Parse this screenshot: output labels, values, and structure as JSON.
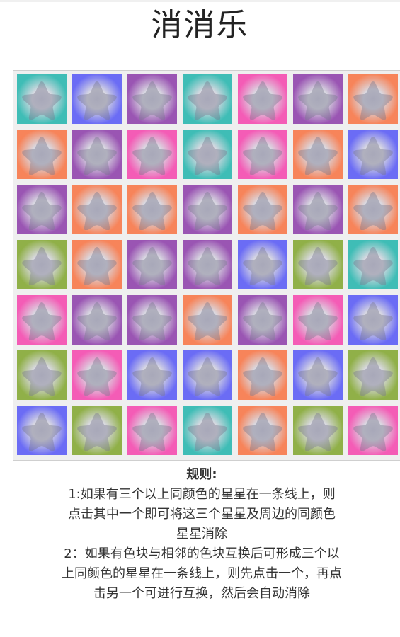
{
  "title": "消消乐",
  "colors": {
    "teal": "#3fbdb6",
    "purple": "#9a55b3",
    "pink": "#f45cb6",
    "orange": "#f7845a",
    "blue": "#6b6cf5",
    "green": "#90b048"
  },
  "icon": "star-icon",
  "board": {
    "rows": [
      [
        "teal",
        "blue",
        "purple",
        "teal",
        "pink",
        "purple",
        "orange"
      ],
      [
        "orange",
        "purple",
        "pink",
        "teal",
        "pink",
        "orange",
        "blue"
      ],
      [
        "purple",
        "orange",
        "orange",
        "purple",
        "orange",
        "purple",
        "orange"
      ],
      [
        "green",
        "orange",
        "purple",
        "purple",
        "blue",
        "green",
        "teal"
      ],
      [
        "pink",
        "purple",
        "purple",
        "orange",
        "purple",
        "pink",
        "blue"
      ],
      [
        "green",
        "pink",
        "blue",
        "blue",
        "orange",
        "blue",
        "green"
      ],
      [
        "blue",
        "green",
        "pink",
        "teal",
        "orange",
        "green",
        "pink"
      ]
    ]
  },
  "rules": {
    "heading": "规则:",
    "rule1": "1:如果有三个以上同颜色的星星在一条线上，则点击其中一个即可将这三个星星及周边的同颜色星星消除",
    "rule2": "2：如果有色块与相邻的色块互换后可形成三个以上同颜色的星星在一条线上，则先点击一个，再点击另一个可进行互换，然后会自动消除"
  }
}
